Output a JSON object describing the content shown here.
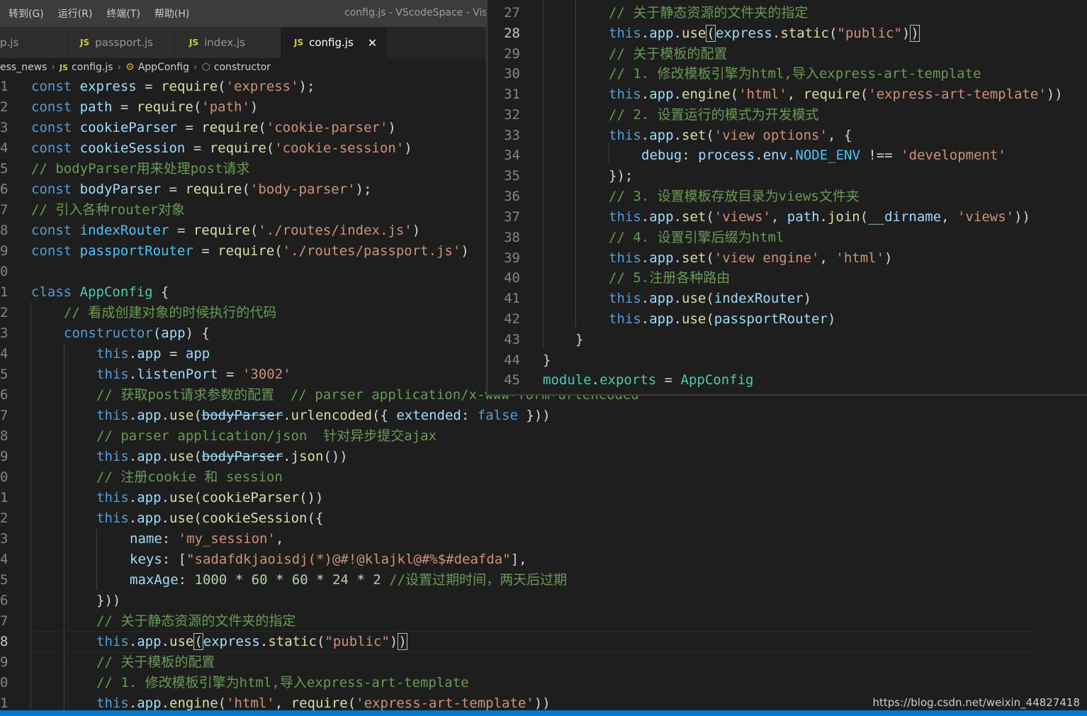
{
  "menubar": {
    "items": [
      "转到(G)",
      "运行(R)",
      "终端(T)",
      "帮助(H)"
    ],
    "window_title": "config.js - VScodeSpace - Visu"
  },
  "tabs": [
    {
      "label": "p.js",
      "active": false
    },
    {
      "label": "passport.js",
      "active": false
    },
    {
      "label": "index.js",
      "active": false
    },
    {
      "label": "config.js",
      "active": true
    }
  ],
  "tab_badge": "JS",
  "tab_close": "✕",
  "breadcrumb": {
    "folder": "ess_news",
    "file_badge": "JS",
    "file": "config.js",
    "class_icon": "class-icon",
    "class": "AppConfig",
    "method_icon": "method-icon",
    "method": "constructor"
  },
  "main_line_numbers": [
    "1",
    "2",
    "3",
    "4",
    "5",
    "6",
    "7",
    "8",
    "9",
    "0",
    "1",
    "2",
    "3",
    "4",
    "5",
    "6",
    "7",
    "8",
    "9",
    "0",
    "1",
    "2",
    "3",
    "4",
    "5",
    "6",
    "7",
    "8",
    "9",
    "0",
    "1"
  ],
  "overlay_line_numbers": [
    "27",
    "28",
    "29",
    "30",
    "31",
    "32",
    "33",
    "34",
    "35",
    "36",
    "37",
    "38",
    "39",
    "40",
    "41",
    "42",
    "43",
    "44",
    "45"
  ],
  "code": {
    "const": "const",
    "require": "require",
    "class": "class",
    "this": "this",
    "app": "app",
    "use": "use",
    "eq": " = ",
    "s_express": "'express'",
    "s_path": "'path'",
    "s_cookie_parser": "'cookie-parser'",
    "s_cookie_session": "'cookie-session'",
    "s_body_parser": "'body-parser'",
    "s_routes_index": "'./routes/index.js'",
    "s_routes_passport": "'./routes/passport.js'",
    "express": "express",
    "path": "path",
    "cookieParser": "cookieParser",
    "cookieSession": "cookieSession",
    "bodyParser": "bodyParser",
    "indexRouter": "indexRouter",
    "passportRouter": "passportRouter",
    "AppConfig": "AppConfig",
    "constructor": "constructor",
    "listenPort": "listenPort",
    "s_3002": "'3002'",
    "urlencoded": "urlencoded",
    "extended": "extended",
    "false": "false",
    "json": "json",
    "name": "name",
    "s_my_session": "'my_session'",
    "keys": "keys",
    "s_keys_val": "\"sadafdkjaoisdj(*)@#!@klajkl@#%$#deafda\"",
    "maxAge": "maxAge",
    "n1000": "1000",
    "n60": "60",
    "n24": "24",
    "n2": "2",
    "static": "static",
    "s_public": "\"public\"",
    "engine": "engine",
    "s_html": "'html'",
    "s_art": "'express-art-template'",
    "set": "set",
    "s_view_options": "'view options'",
    "debug": "debug",
    "process": "process",
    "env": "env",
    "NODE_ENV": "NODE_ENV",
    "s_development": "'development'",
    "s_views": "'views'",
    "join": "join",
    "dirname": "__dirname",
    "s_view_engine": "'view engine'",
    "module": "module",
    "exports": "exports",
    "c_bodyparser": "// bodyParser用来处理post请求",
    "c_router": "// 引入各种router对象",
    "c_ctor": "// 看成创建对象的时候执行的代码",
    "c_post": "// 获取post请求参数的配置  // parser application/x-www-form-urlencoded",
    "c_json": "// parser application/json  针对异步提交ajax",
    "c_cookie": "// 注册cookie 和 session",
    "c_expire": "//设置过期时间，两天后过期",
    "c_static": "// 关于静态资源的文件夹的指定",
    "c_tpl": "// 关于模板的配置",
    "c_tpl1": "// 1. 修改模板引擎为html,导入express-art-template",
    "c_tpl2": "// 2. 设置运行的模式为开发模式",
    "c_tpl3": "// 3. 设置模板存放目录为views文件夹",
    "c_tpl4": "// 4. 设置引擎后缀为html",
    "c_tpl5": "// 5.注册各种路由"
  },
  "watermark": "https://blog.csdn.net/weixin_44827418"
}
